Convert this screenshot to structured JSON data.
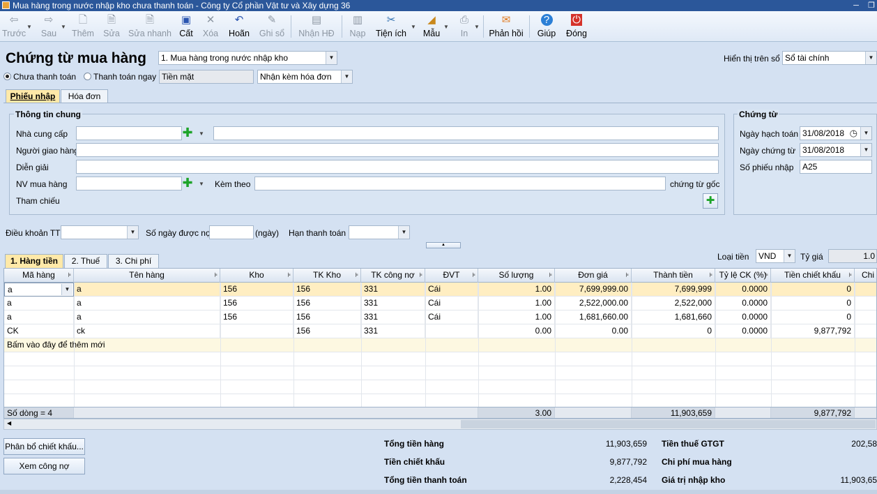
{
  "title": "Mua hàng trong nước nhập kho chưa thanh toán - Công ty Cổ phần Vật tư và Xây dựng 36",
  "toolbar": [
    {
      "label": "Trước",
      "icon": "arrow-left-icon",
      "enabled": false
    },
    {
      "label": "Sau",
      "icon": "arrow-right-icon",
      "enabled": false
    },
    {
      "label": "Thêm",
      "icon": "add-doc-icon",
      "enabled": false
    },
    {
      "label": "Sửa",
      "icon": "edit-doc-icon",
      "enabled": false
    },
    {
      "label": "Sửa nhanh",
      "icon": "quick-edit-icon",
      "enabled": false
    },
    {
      "label": "Cất",
      "icon": "save-icon",
      "enabled": true
    },
    {
      "label": "Xóa",
      "icon": "delete-icon",
      "enabled": false
    },
    {
      "label": "Hoãn",
      "icon": "undo-icon",
      "enabled": true
    },
    {
      "label": "Ghi sổ",
      "icon": "post-icon",
      "enabled": false
    },
    {
      "label": "Nhận HĐ",
      "icon": "invoice-icon",
      "enabled": false
    },
    {
      "label": "Nạp",
      "icon": "load-icon",
      "enabled": false
    },
    {
      "label": "Tiện ích",
      "icon": "tools-icon",
      "enabled": true
    },
    {
      "label": "Mẫu",
      "icon": "template-icon",
      "enabled": true
    },
    {
      "label": "In",
      "icon": "print-icon",
      "enabled": false
    },
    {
      "label": "Phản hồi",
      "icon": "mail-icon",
      "enabled": true
    },
    {
      "label": "Giúp",
      "icon": "help-icon",
      "enabled": true
    },
    {
      "label": "Đóng",
      "icon": "close-icon",
      "enabled": true
    }
  ],
  "header": {
    "heading": "Chứng từ mua hàng",
    "doc_type": "1. Mua hàng trong nước nhập kho",
    "display_label": "Hiển thị trên sổ",
    "display_value": "Sổ tài chính",
    "radio_unpaid": "Chưa thanh toán",
    "radio_paid": "Thanh toán ngay",
    "payment_method": "Tiền mặt",
    "invoice_option": "Nhận kèm hóa đơn"
  },
  "tabs": {
    "receipt": "Phiếu nhập",
    "invoice": "Hóa đơn"
  },
  "general": {
    "title": "Thông tin chung",
    "supplier": "Nhà cung cấp",
    "deliverer": "Người giao hàng",
    "description": "Diễn giải",
    "buyer": "NV mua hàng",
    "attached": "Kèm theo",
    "original_docs": "chứng từ gốc",
    "reference": "Tham chiếu"
  },
  "voucher": {
    "title": "Chứng từ",
    "posting_date_label": "Ngày hạch toán",
    "posting_date": "31/08/2018",
    "doc_date_label": "Ngày chứng từ",
    "doc_date": "31/08/2018",
    "receipt_no_label": "Số phiếu nhập",
    "receipt_no": "A25"
  },
  "terms": {
    "payment_terms": "Điều khoản TT",
    "credit_days": "Số ngày được nợ",
    "days_unit": "(ngày)",
    "due_date": "Hạn thanh toán"
  },
  "detail_tabs": {
    "goods": "1. Hàng tiền",
    "tax": "2. Thuế",
    "cost": "3. Chi phí"
  },
  "currency": {
    "label": "Loại tiền",
    "value": "VND",
    "rate_label": "Tỷ giá",
    "rate": "1.0"
  },
  "grid": {
    "columns": [
      "Mã hàng",
      "Tên hàng",
      "Kho",
      "TK Kho",
      "TK công nợ",
      "ĐVT",
      "Số lượng",
      "Đơn giá",
      "Thành tiền",
      "Tỷ lệ CK (%)",
      "Tiền chiết khấu",
      "Chi p"
    ],
    "rows": [
      [
        "a",
        "a",
        "156",
        "156",
        "331",
        "Cái",
        "1.00",
        "7,699,999.00",
        "7,699,999",
        "0.0000",
        "0",
        ""
      ],
      [
        "a",
        "a",
        "156",
        "156",
        "331",
        "Cái",
        "1.00",
        "2,522,000.00",
        "2,522,000",
        "0.0000",
        "0",
        ""
      ],
      [
        "a",
        "a",
        "156",
        "156",
        "331",
        "Cái",
        "1.00",
        "1,681,660.00",
        "1,681,660",
        "0.0000",
        "0",
        ""
      ],
      [
        "CK",
        "ck",
        "",
        "156",
        "331",
        "",
        "0.00",
        "0.00",
        "0",
        "0.0000",
        "9,877,792",
        ""
      ]
    ],
    "add_new": "Bấm vào đây để thêm mới",
    "row_count": "Số dòng = 4",
    "total_qty": "3.00",
    "total_amount": "11,903,659",
    "total_discount": "9,877,792"
  },
  "buttons": {
    "allocate": "Phân bổ chiết khấu...",
    "view_debt": "Xem công nợ"
  },
  "summary": {
    "goods_total_label": "Tổng tiền hàng",
    "goods_total": "11,903,659",
    "discount_label": "Tiền chiết khấu",
    "discount": "9,877,792",
    "payment_total_label": "Tổng tiền thanh toán",
    "payment_total": "2,228,454",
    "vat_label": "Tiền thuế GTGT",
    "vat": "202,58",
    "purchase_cost_label": "Chi phí mua hàng",
    "import_value_label": "Giá trị nhập kho",
    "import_value": "11,903,65"
  }
}
